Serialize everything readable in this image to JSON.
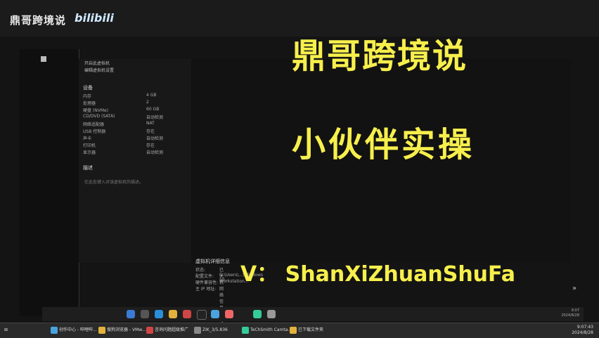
{
  "watermark": {
    "channel": "鼎哥跨境说",
    "platform": "bilibili"
  },
  "overlay": {
    "title": "鼎哥跨境说",
    "subtitle": "小伙伴实操",
    "contact": "V： ShanXiZhuanShuFa"
  },
  "vm_panel": {
    "actions": [
      "开启此虚拟机",
      "编辑虚拟机设置"
    ],
    "devices_header": "设备",
    "devices": [
      {
        "name": "内存",
        "value": "4 GB"
      },
      {
        "name": "处理器",
        "value": "2"
      },
      {
        "name": "硬盘 (NVMe)",
        "value": "60 GB"
      },
      {
        "name": "CD/DVD (SATA)",
        "value": "自动检测"
      },
      {
        "name": "网络适配器",
        "value": "NAT"
      },
      {
        "name": "USB 控制器",
        "value": "存在"
      },
      {
        "name": "声卡",
        "value": "自动检测"
      },
      {
        "name": "打印机",
        "value": "存在"
      },
      {
        "name": "显示器",
        "value": "自动检测"
      }
    ],
    "description_header": "描述",
    "description_placeholder": "在此处键入对该虚拟机的描述。"
  },
  "details": {
    "header": "虚拟机详细信息",
    "rows": [
      {
        "label": "状态:",
        "value": "已关机"
      },
      {
        "label": "配置文件:",
        "value": "D:\\Users\\...\\Windows 10..."
      },
      {
        "label": "硬件兼容性:",
        "value": "Workstation..."
      },
      {
        "label": "主 IP 地址:",
        "value": "网络信息不可用"
      }
    ]
  },
  "vm_clock": {
    "time": "9:07",
    "date": "2024/8/28"
  },
  "host_taskbar": {
    "items": [
      "创作中心 - 哔哩哔...",
      "搜狗浏览器 - VMw...",
      "咨询问题超级推广",
      "ZIK_3/5.836",
      "TeChSmith Camta...",
      "已下载文件夹"
    ],
    "time": "9:07:43",
    "date": "2024/8/28"
  },
  "colors": {
    "overlay_text": "#f7ef4c"
  }
}
